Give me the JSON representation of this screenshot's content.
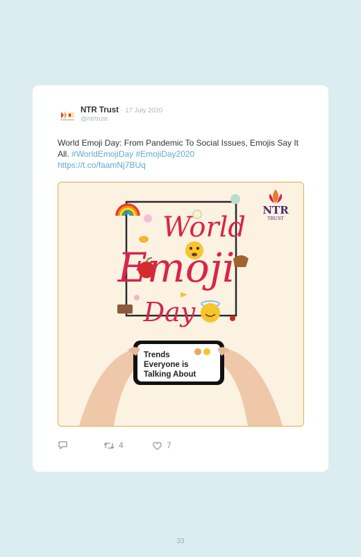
{
  "tweet": {
    "author_name": "NTR Trust",
    "separator": "·",
    "date": "17 July 2020",
    "handle": "@ntrtrust",
    "text": "World Emoji Day: From Pandemic To Social Issues, Emojis Say It All.",
    "hashtag_1": "#WorldEmojiDay",
    "hashtag_2": "#EmojiDay2020",
    "link": "https://t.co/faamNj7BUq"
  },
  "media": {
    "title_word_1": "World",
    "title_word_2": "Emoji",
    "title_word_3": "Day",
    "logo_text": "NTR",
    "logo_subtext": "TRUST",
    "phone_text_line_1": "Trends",
    "phone_text_line_2": "Everyone is",
    "phone_text_line_3": "Talking About",
    "title_color": "#d8254a",
    "background_color": "#fbf2e2"
  },
  "actions": {
    "retweet_count": "4",
    "like_count": "7"
  },
  "page_number": "33",
  "icons": [
    "reply-icon",
    "retweet-icon",
    "like-icon"
  ]
}
